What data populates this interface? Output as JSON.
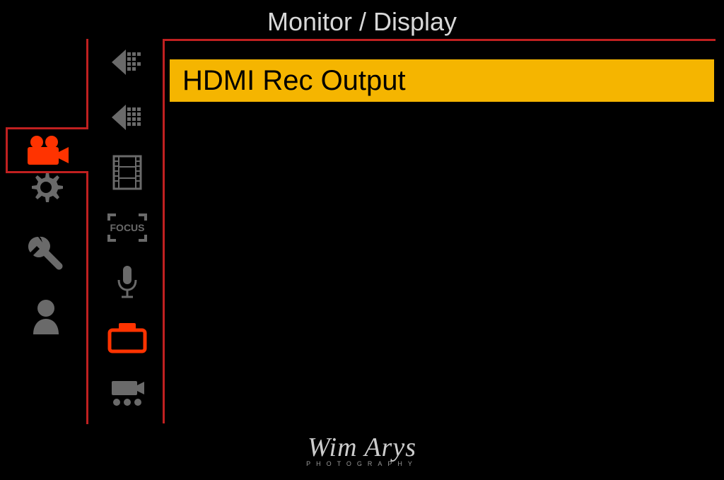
{
  "header": {
    "title": "Monitor / Display"
  },
  "mainSidebar": {
    "items": [
      {
        "name": "video-camera",
        "active": true
      },
      {
        "name": "settings-gear",
        "active": false
      },
      {
        "name": "wrench-tool",
        "active": false
      },
      {
        "name": "user-profile",
        "active": false
      }
    ]
  },
  "subSidebar": {
    "items": [
      {
        "name": "back-arrow-dots",
        "active": false
      },
      {
        "name": "back-arrow-solid",
        "active": false
      },
      {
        "name": "film-strip",
        "active": false
      },
      {
        "name": "focus-bracket",
        "active": false,
        "label": "FOCUS"
      },
      {
        "name": "microphone",
        "active": false
      },
      {
        "name": "camera-monitor",
        "active": true
      },
      {
        "name": "camera-dots",
        "active": false
      }
    ]
  },
  "menu": {
    "items": [
      {
        "label": "HDMI Rec Output",
        "selected": true
      }
    ]
  },
  "watermark": {
    "name": "Wim Arys",
    "subtitle": "PHOTOGRAPHY"
  },
  "colors": {
    "accent": "#c02020",
    "highlight": "#f5b500",
    "active": "#ff3300",
    "inactive": "#6a6a6a"
  }
}
